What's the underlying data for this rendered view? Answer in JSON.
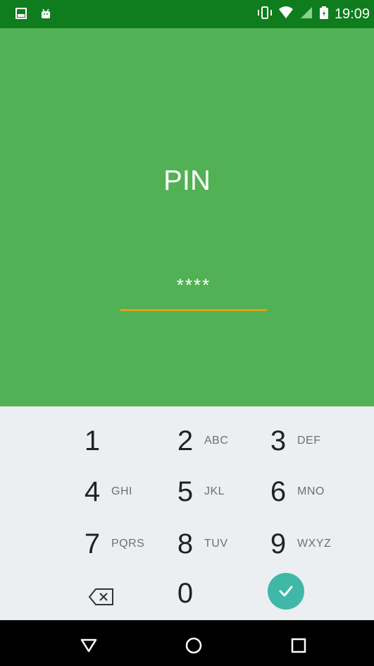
{
  "status_bar": {
    "time": "19:09",
    "left_icons": [
      "image-icon",
      "android-icon"
    ],
    "right_icons": [
      "vibrate-icon",
      "wifi-icon",
      "signal-icon",
      "battery-icon"
    ]
  },
  "pin_screen": {
    "title": "PIN",
    "masked_value": "****",
    "accent_color": "#e0a21b",
    "background_color": "#51b154"
  },
  "keypad": {
    "keys": [
      {
        "digit": "1",
        "letters": ""
      },
      {
        "digit": "2",
        "letters": "ABC"
      },
      {
        "digit": "3",
        "letters": "DEF"
      },
      {
        "digit": "4",
        "letters": "GHI"
      },
      {
        "digit": "5",
        "letters": "JKL"
      },
      {
        "digit": "6",
        "letters": "MNO"
      },
      {
        "digit": "7",
        "letters": "PQRS"
      },
      {
        "digit": "8",
        "letters": "TUV"
      },
      {
        "digit": "9",
        "letters": "WXYZ"
      },
      {
        "digit": "0",
        "letters": ""
      }
    ],
    "backspace_icon": "backspace-icon",
    "confirm_icon": "check-icon",
    "confirm_color": "#3fb8a8"
  },
  "nav_bar": {
    "buttons": [
      "back-icon",
      "home-icon",
      "recents-icon"
    ]
  }
}
